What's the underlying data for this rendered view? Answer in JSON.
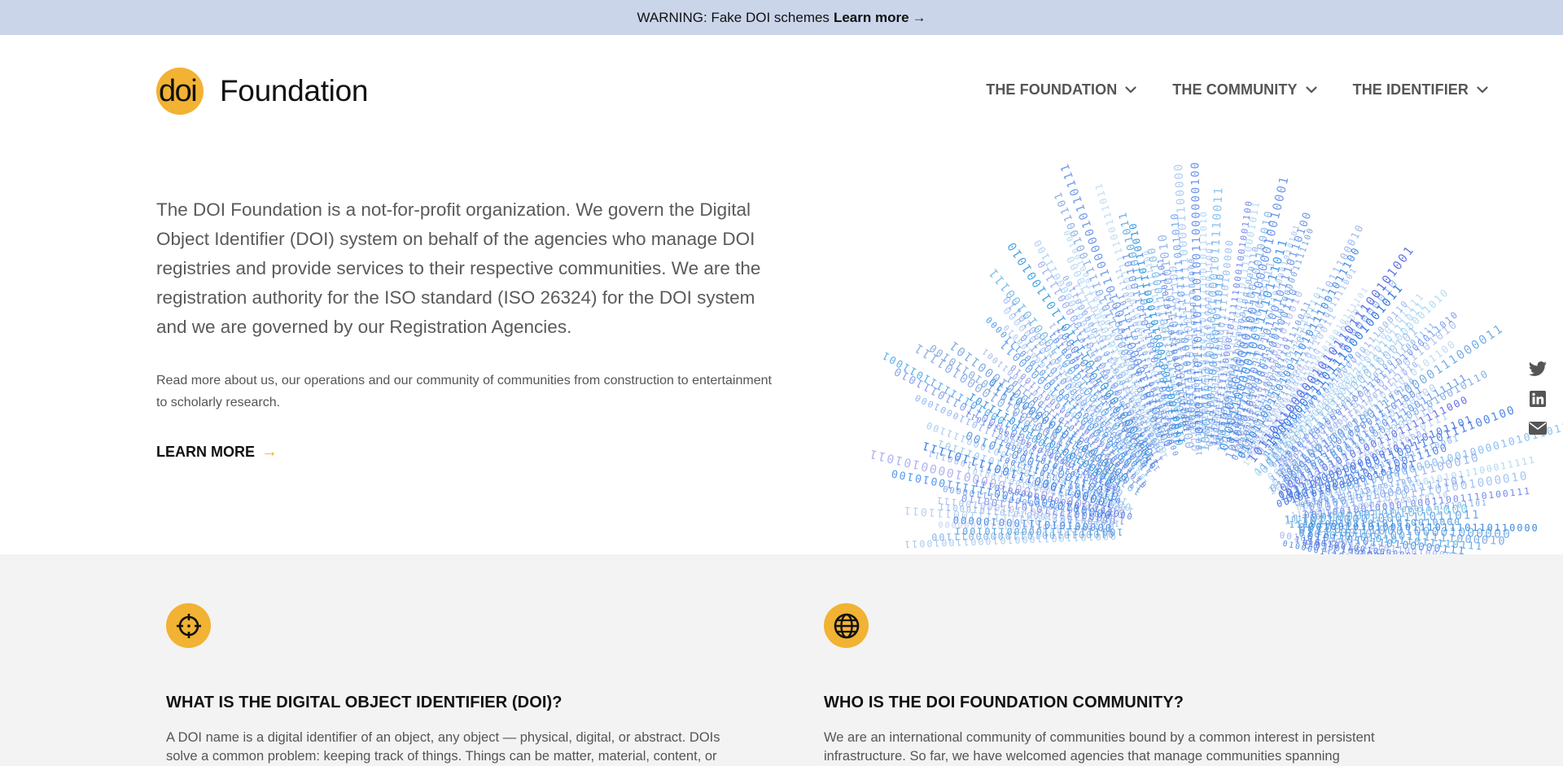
{
  "warning": {
    "text": "WARNING: Fake DOI schemes",
    "link_label": "Learn more",
    "arrow": "→"
  },
  "logo": {
    "mark": "doi",
    "name": "Foundation"
  },
  "nav": {
    "items": [
      {
        "label": "THE FOUNDATION",
        "icon": "chevron-down-icon"
      },
      {
        "label": "THE COMMUNITY",
        "icon": "chevron-down-icon"
      },
      {
        "label": "THE IDENTIFIER",
        "icon": "chevron-down-icon"
      }
    ]
  },
  "hero": {
    "lead": "The DOI Foundation is a not-for-profit organization. We govern the Digital Object Identifier (DOI) system on behalf of the agencies who manage DOI registries and provide services to their respective communities. We are the registration authority for the ISO standard (ISO 26324) for the DOI system and we are governed by our Registration Agencies.",
    "sub": "Read more about us, our operations and our community of communities from construction to entertainment to scholarly research.",
    "cta_label": "LEARN MORE",
    "cta_arrow": "→"
  },
  "social": {
    "icons": [
      "twitter-icon",
      "linkedin-icon",
      "email-icon"
    ]
  },
  "cards": [
    {
      "icon": "crosshair-icon",
      "title": "WHAT IS THE DIGITAL OBJECT IDENTIFIER (DOI)?",
      "text": "A DOI name is a digital identifier of an object, any object — physical, digital, or abstract. DOIs solve a common problem: keeping track of things. Things can be matter, material, content, or activities."
    },
    {
      "icon": "globe-icon",
      "title": "WHO IS THE DOI FOUNDATION COMMUNITY?",
      "text": "We are an international community of communities bound by a common interest in persistent infrastructure. So far, we have welcomed agencies that manage communities spanning entertainment"
    }
  ],
  "colors": {
    "accent": "#f2b233",
    "warning_bg": "#cbd5ea",
    "lower_bg": "#f3f3f3",
    "binary_dark": "#1f5bd6",
    "binary_light": "#86c3f0"
  }
}
